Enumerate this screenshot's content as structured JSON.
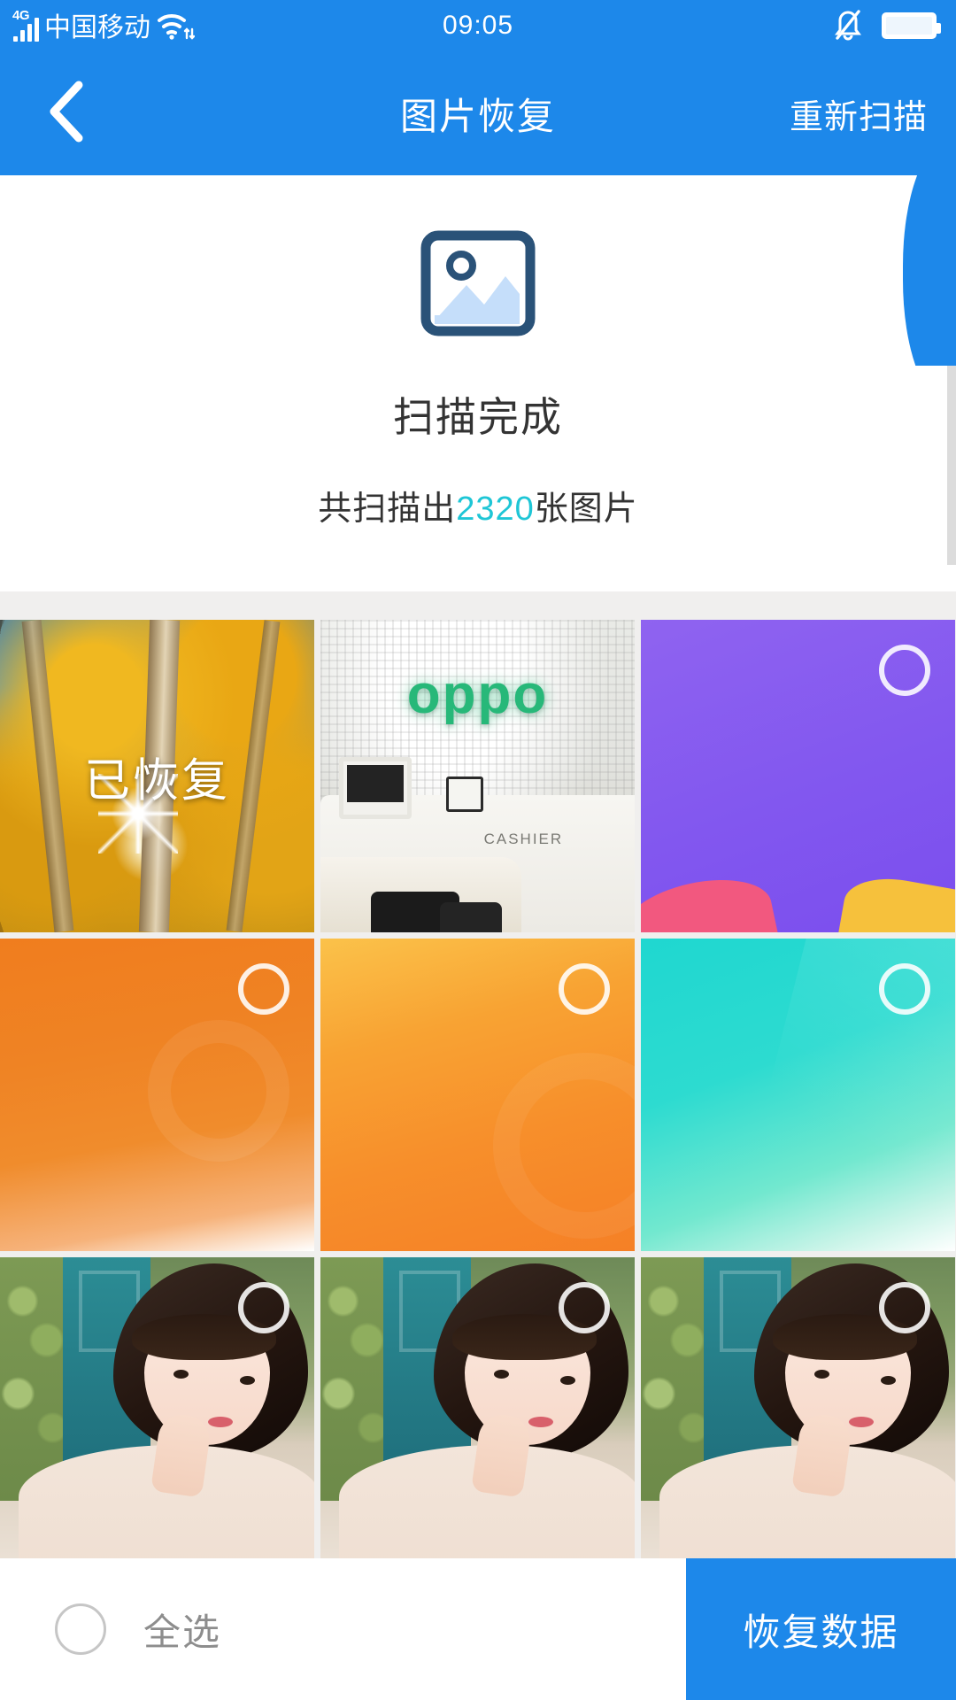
{
  "statusbar": {
    "network_type": "4G",
    "carrier": "中国移动",
    "time": "09:05",
    "icons": {
      "signal": "signal-bars-icon",
      "wifi": "wifi-icon",
      "data_arrows": "data-transfer-arrows-icon",
      "silent": "bell-muted-icon",
      "battery": "battery-full-icon"
    }
  },
  "navbar": {
    "back_icon": "chevron-left-icon",
    "title": "图片恢复",
    "action_label": "重新扫描"
  },
  "result": {
    "icon": "image-placeholder-icon",
    "title": "扫描完成",
    "summary_prefix": "共扫描出",
    "count": "2320",
    "summary_suffix": "张图片",
    "count_color": "#1ec6d6"
  },
  "grid": {
    "tiles": [
      {
        "art": "art-forest",
        "name": "photo-autumn-forest",
        "selected": true,
        "badge": "已恢复",
        "checkbox": false
      },
      {
        "art": "art-oppo",
        "name": "photo-oppo-store",
        "selected": false,
        "badge": "",
        "checkbox": false,
        "logo": "oppo",
        "counter_label": "CASHIER"
      },
      {
        "art": "art-purple",
        "name": "photo-purple-wallpaper",
        "selected": false,
        "badge": "",
        "checkbox": true
      },
      {
        "art": "art-orange",
        "name": "photo-orange-wallpaper",
        "selected": false,
        "badge": "",
        "checkbox": true
      },
      {
        "art": "art-orange2",
        "name": "photo-amber-wallpaper",
        "selected": false,
        "badge": "",
        "checkbox": true
      },
      {
        "art": "art-teal",
        "name": "photo-teal-wallpaper",
        "selected": false,
        "badge": "",
        "checkbox": true
      },
      {
        "art": "art-selfie",
        "name": "photo-portrait-1",
        "selected": false,
        "badge": "",
        "checkbox": true
      },
      {
        "art": "art-selfie",
        "name": "photo-portrait-2",
        "selected": false,
        "badge": "",
        "checkbox": true
      },
      {
        "art": "art-selfie",
        "name": "photo-portrait-3",
        "selected": false,
        "badge": "",
        "checkbox": true
      }
    ]
  },
  "bottombar": {
    "select_all_label": "全选",
    "select_all_checked": false,
    "recover_label": "恢复数据"
  },
  "colors": {
    "primary_blue": "#1d88ea",
    "accent_cyan": "#1ec6d6",
    "page_bg": "#f0efee",
    "text_dark": "#333333",
    "text_muted": "#8d8d8d"
  }
}
